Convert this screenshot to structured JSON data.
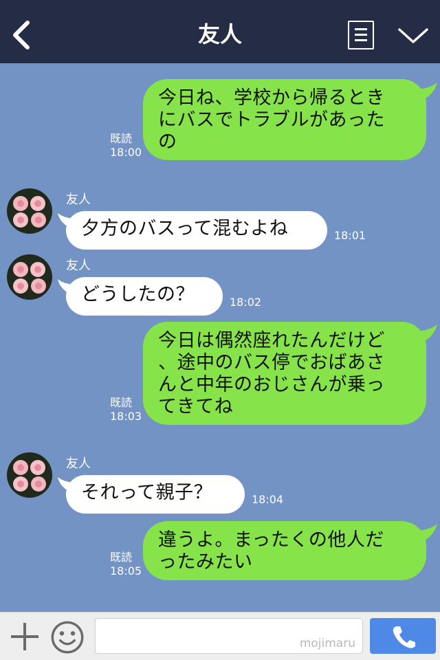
{
  "header": {
    "title": "友人"
  },
  "icons": {
    "back": "back-chevron-icon",
    "notes": "notes-icon",
    "menu": "chevron-down-icon"
  },
  "contact": {
    "name": "友人"
  },
  "messages": [
    {
      "side": "me",
      "lines": [
        "今日ね、学校から帰るとき",
        "にバスでトラブルがあった",
        "の"
      ],
      "read": "既読",
      "time": "18:00"
    },
    {
      "side": "them",
      "name": "友人",
      "text": "夕方のバスって混むよね",
      "time": "18:01"
    },
    {
      "side": "them",
      "name": "友人",
      "text": "どうしたの？",
      "time": "18:02"
    },
    {
      "side": "me",
      "lines": [
        "今日は偶然座れたんだけど",
        "、途中のバス停でおばあさ",
        "んと中年のおじさんが乗っ",
        "てきてね"
      ],
      "read": "既読",
      "time": "18:03"
    },
    {
      "side": "them",
      "name": "友人",
      "text": "それって親子？",
      "time": "18:04"
    },
    {
      "side": "me",
      "lines": [
        "違うよ。まったくの他人だ",
        "ったみたい"
      ],
      "read": "既読",
      "time": "18:05"
    }
  ],
  "input": {
    "watermark": "mojimaru"
  },
  "colors": {
    "header": "#242d45",
    "chat_bg": "#7393c4",
    "my_bubble": "#86e34a",
    "their_bubble": "#ffffff",
    "send": "#4f89e8"
  }
}
